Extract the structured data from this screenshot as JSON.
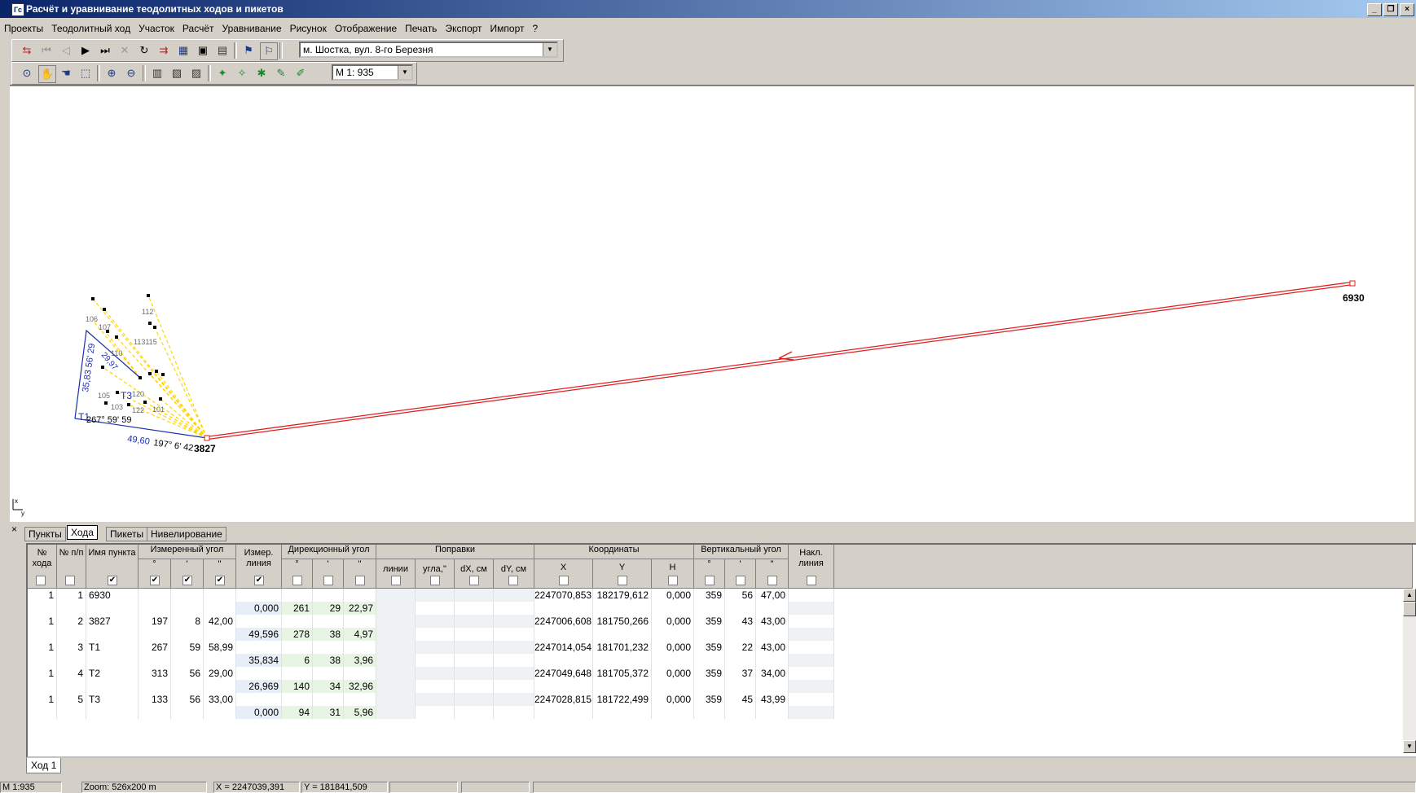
{
  "window": {
    "title": "Расчёт и уравнивание теодолитных ходов и пикетов",
    "app_icon": "Гс"
  },
  "menu": [
    "Проекты",
    "Теодолитный ход",
    "Участок",
    "Расчёт",
    "Уравнивание",
    "Рисунок",
    "Отображение",
    "Печать",
    "Экспорт",
    "Импорт",
    "?"
  ],
  "toolbar": {
    "site_select_value": "м. Шостка, вул. 8-го Березня",
    "scale_select_value": "М 1: 935"
  },
  "drawing": {
    "point_labels": {
      "p6930": "6930",
      "p3827": "3827",
      "t1": "Т1",
      "t3": "Т3",
      "p106": "106",
      "p107": "107",
      "p112": "112",
      "p113": "113115",
      "p110": "110",
      "p105": "105",
      "p103": "103",
      "p122": "122",
      "p101": "101",
      "p120": "120"
    },
    "annotations": {
      "line_3827_t1": "49,60",
      "angle_3827": "197° 6' 42",
      "angle_t1": "267° 59' 59",
      "vertical_annot": "35,83 56' 29",
      "diag_annot": "29,97"
    },
    "colors": {
      "traverse_line": "#e02020",
      "survey_line": "#1c2fb0",
      "picket_dashed": "#ffd400",
      "picket_marker": "#000000",
      "label_gray": "#6a6a6a"
    }
  },
  "panel": {
    "close_glyph": "×",
    "tabs": [
      "Пункты",
      "Хода",
      "Пикеты",
      "Нивелирование"
    ],
    "active_tab": "Хода",
    "bottom_tab": "Ход 1"
  },
  "table": {
    "headers": {
      "num_hoda": "№ хода",
      "num_pp": "№ п/п",
      "name": "Имя пункта",
      "meas_angle": "Измеренный угол",
      "meas_line": "Измер. линия",
      "dir_angle": "Дирекционный угол",
      "corrections": "Поправки",
      "coords": "Координаты",
      "vert_angle": "Вертикальный угол",
      "incl_line": "Накл. линия",
      "deg": "°",
      "min": "'",
      "sec": "''",
      "lines": "линии",
      "angle_corr": "угла,''",
      "dx": "dX, см",
      "dy": "dY, см",
      "x": "X",
      "y": "Y",
      "h": "H"
    },
    "checked_columns": [
      "name",
      "ma_deg",
      "ma_min",
      "ma_sec",
      "meas_line"
    ],
    "stations": [
      {
        "hod": "1",
        "pp": "1",
        "name": "6930",
        "ma_deg": "",
        "ma_min": "",
        "ma_sec": "",
        "x": "2247070,853",
        "y": "182179,612",
        "h": "0,000",
        "va_deg": "359",
        "va_min": "56",
        "va_sec": "47,00"
      },
      {
        "hod": "1",
        "pp": "2",
        "name": "3827",
        "ma_deg": "197",
        "ma_min": "8",
        "ma_sec": "42,00",
        "x": "2247006,608",
        "y": "181750,266",
        "h": "0,000",
        "va_deg": "359",
        "va_min": "43",
        "va_sec": "43,00"
      },
      {
        "hod": "1",
        "pp": "3",
        "name": "Т1",
        "ma_deg": "267",
        "ma_min": "59",
        "ma_sec": "58,99",
        "x": "2247014,054",
        "y": "181701,232",
        "h": "0,000",
        "va_deg": "359",
        "va_min": "22",
        "va_sec": "43,00"
      },
      {
        "hod": "1",
        "pp": "4",
        "name": "Т2",
        "ma_deg": "313",
        "ma_min": "56",
        "ma_sec": "29,00",
        "x": "2247049,648",
        "y": "181705,372",
        "h": "0,000",
        "va_deg": "359",
        "va_min": "37",
        "va_sec": "34,00"
      },
      {
        "hod": "1",
        "pp": "5",
        "name": "Т3",
        "ma_deg": "133",
        "ma_min": "56",
        "ma_sec": "33,00",
        "x": "2247028,815",
        "y": "181722,499",
        "h": "0,000",
        "va_deg": "359",
        "va_min": "45",
        "va_sec": "43,99"
      }
    ],
    "lines": [
      {
        "line": "0,000",
        "dir_deg": "261",
        "dir_min": "29",
        "dir_sec": "22,97"
      },
      {
        "line": "49,596",
        "dir_deg": "278",
        "dir_min": "38",
        "dir_sec": "4,97"
      },
      {
        "line": "35,834",
        "dir_deg": "6",
        "dir_min": "38",
        "dir_sec": "3,96"
      },
      {
        "line": "26,969",
        "dir_deg": "140",
        "dir_min": "34",
        "dir_sec": "32,96"
      },
      {
        "line": "0,000",
        "dir_deg": "94",
        "dir_min": "31",
        "dir_sec": "5,96"
      }
    ]
  },
  "status": {
    "scale": "М 1:935",
    "zoom": "Zoom: 526x200 m",
    "x": "X = 2247039,391",
    "y": "Y = 181841,509"
  }
}
